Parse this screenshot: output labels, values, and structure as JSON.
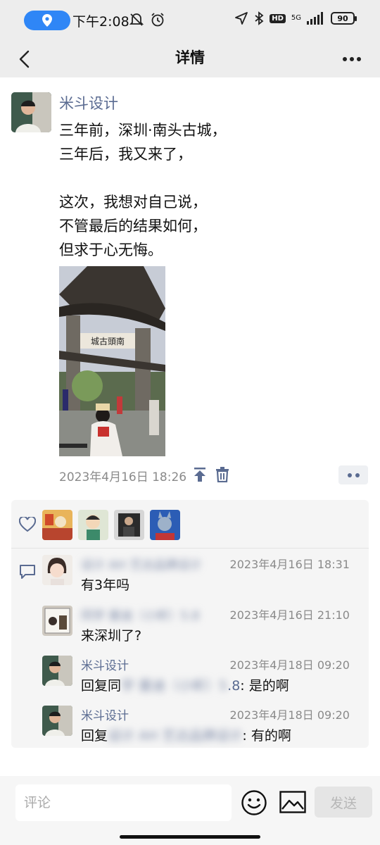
{
  "status_bar": {
    "time": "下午2:08",
    "network": "5G",
    "hd": "HD",
    "battery": "90"
  },
  "header": {
    "title": "详情"
  },
  "post": {
    "author": "米斗设计",
    "lines": [
      "三年前，深圳·南头古城，",
      "三年后，我又来了，",
      " ",
      "这次，我想对自己说，",
      "不管最后的结果如何，",
      "但求于心无悔。"
    ],
    "time": "2023年4月16日 18:26"
  },
  "comments": [
    {
      "name": "设计 AH 艺达品牌设计",
      "time": "2023年4月16日 18:31",
      "prefix": "",
      "reply_to": "",
      "reply_suffix": "",
      "text": "有3年吗"
    },
    {
      "name": "同学 曼迪（小昕）5.8",
      "time": "2023年4月16日 21:10",
      "prefix": "",
      "reply_to": "",
      "reply_suffix": "",
      "text": "来深圳了?"
    },
    {
      "name": "米斗设计",
      "time": "2023年4月18日 09:20",
      "prefix": "回复同",
      "reply_to": "学 曼迪（小昕）5",
      "reply_suffix": ".8",
      "text": ": 是的啊"
    },
    {
      "name": "米斗设计",
      "time": "2023年4月18日 09:20",
      "prefix": "回复",
      "reply_to": "设计 AH 艺达品牌设计",
      "reply_suffix": "",
      "text": ": 有的啊"
    }
  ],
  "bottom": {
    "input_placeholder": "评论",
    "send_label": "发送"
  },
  "colors": {
    "name_blue": "#5a6b91",
    "pill_blue": "#2f86f6"
  }
}
